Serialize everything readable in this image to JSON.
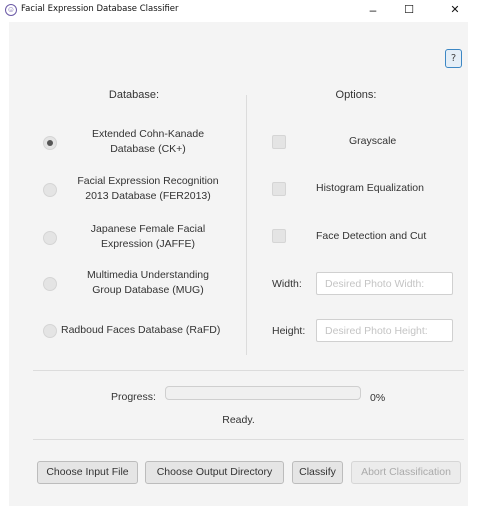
{
  "window": {
    "title": "Facial Expression Database Classifier",
    "app_icon": "smiley-icon",
    "minimize": "–",
    "maximize": "☐",
    "close": "✕"
  },
  "help_button": {
    "label": "?"
  },
  "database": {
    "header": "Database:",
    "options": [
      {
        "line1": "Extended Cohn-Kanade",
        "line2": "Database (CK+)",
        "selected": true
      },
      {
        "line1": "Facial Expression Recognition",
        "line2": "2013 Database (FER2013)",
        "selected": false
      },
      {
        "line1": "Japanese Female Facial",
        "line2": "Expression (JAFFE)",
        "selected": false
      },
      {
        "line1": "Multimedia Understanding",
        "line2": "Group Database (MUG)",
        "selected": false
      },
      {
        "line1": "Radboud Faces Database (RaFD)",
        "line2": "",
        "selected": false
      }
    ]
  },
  "options": {
    "header": "Options:",
    "checkboxes": [
      {
        "label": "Grayscale",
        "checked": false
      },
      {
        "label": "Histogram Equalization",
        "checked": false
      },
      {
        "label": "Face Detection and Cut",
        "checked": false
      }
    ],
    "width_label": "Width:",
    "width_placeholder": "Desired Photo Width:",
    "width_value": "",
    "height_label": "Height:",
    "height_placeholder": "Desired Photo Height:",
    "height_value": ""
  },
  "progress": {
    "label": "Progress:",
    "value": 0,
    "percent_text": "0%",
    "status": "Ready."
  },
  "buttons": {
    "choose_input": "Choose Input File",
    "choose_output": "Choose Output Directory",
    "classify": "Classify",
    "abort": "Abort Classification"
  }
}
